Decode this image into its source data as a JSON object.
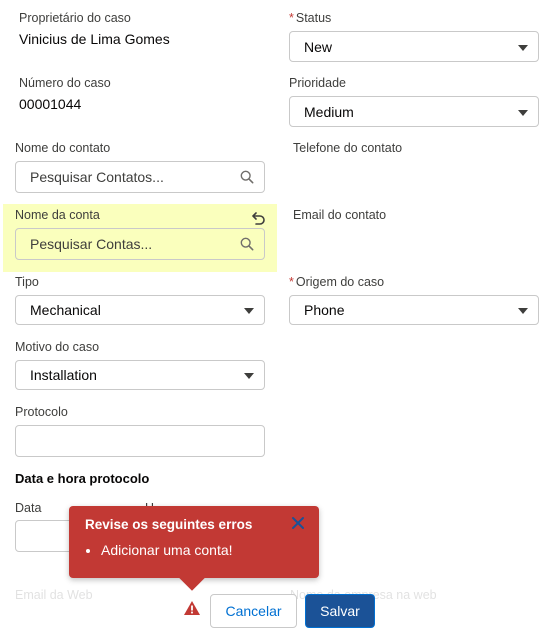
{
  "left": {
    "owner_label": "Proprietário do caso",
    "owner_value": "Vinicius de Lima Gomes",
    "case_number_label": "Número do caso",
    "case_number_value": "00001044",
    "contact_label": "Nome do contato",
    "contact_placeholder": "Pesquisar Contatos...",
    "account_label": "Nome da conta",
    "account_placeholder": "Pesquisar Contas...",
    "type_label": "Tipo",
    "type_value": "Mechanical",
    "reason_label": "Motivo do caso",
    "reason_value": "Installation",
    "protocol_label": "Protocolo",
    "protocol_value": ""
  },
  "right": {
    "status_label": "Status",
    "status_value": "New",
    "priority_label": "Prioridade",
    "priority_value": "Medium",
    "contact_phone_label": "Telefone do contato",
    "contact_email_label": "Email do contato",
    "origin_label": "Origem do caso",
    "origin_value": "Phone"
  },
  "datetime": {
    "section_label": "Data e hora protocolo",
    "date_label": "Data",
    "time_label_partial": "H"
  },
  "faded": {
    "web_email_label": "Email da Web",
    "right_label_partial": "Nome da empresa na web"
  },
  "error_popover": {
    "title": "Revise os seguintes erros",
    "items": [
      "Adicionar uma conta!"
    ]
  },
  "footer": {
    "cancel_label": "Cancelar",
    "save_label": "Salvar"
  },
  "colors": {
    "highlight": "#faffbd",
    "error": "#c23934",
    "brand": "#1b5297",
    "link": "#0070d2"
  }
}
